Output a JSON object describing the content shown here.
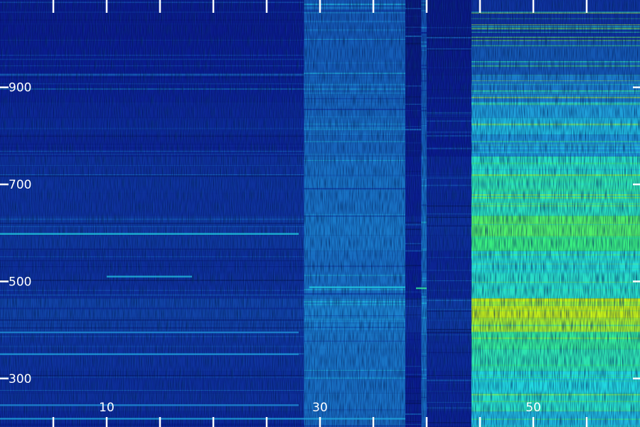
{
  "chart_data": {
    "type": "heatmap",
    "title": "",
    "xlabel": "",
    "ylabel": "",
    "xlim": [
      0,
      60
    ],
    "ylim": [
      200,
      1080
    ],
    "grid": false,
    "legend": "none",
    "x_tick_labels": [
      {
        "value": 10,
        "label": "10"
      },
      {
        "value": 30,
        "label": "30"
      },
      {
        "value": 50,
        "label": "50"
      }
    ],
    "x_minor_ticks": [
      5,
      10,
      15,
      20,
      25,
      30,
      35,
      40,
      45,
      50,
      55
    ],
    "y_tick_labels": [
      {
        "value": 300,
        "label": "300"
      },
      {
        "value": 500,
        "label": "500"
      },
      {
        "value": 700,
        "label": "700"
      },
      {
        "value": 900,
        "label": "900"
      }
    ],
    "colors": {
      "background": "#06104a",
      "low": "#0a1a8c",
      "mid": "#1e8fd6",
      "cyan": "#22d8e0",
      "green": "#3af07a",
      "yellow": "#e8f000",
      "tick": "#ffffff",
      "tick_label": "#ffffff"
    },
    "intensity_scale": [
      0,
      1
    ],
    "time_regions": [
      {
        "x0": 0,
        "x1": 28.5,
        "level": 0.18
      },
      {
        "x0": 28.5,
        "x1": 38,
        "level": 0.32
      },
      {
        "x0": 38,
        "x1": 39.5,
        "level": 0.14
      },
      {
        "x0": 39.5,
        "x1": 40,
        "level": 0.3
      },
      {
        "x0": 40,
        "x1": 44.2,
        "level": 0.16
      },
      {
        "x0": 44.2,
        "x1": 60,
        "level": 0.72
      }
    ],
    "frequency_bands": [
      {
        "y": 1030,
        "level": 0.2
      },
      {
        "y": 960,
        "level": 0.28
      },
      {
        "y": 890,
        "level": 0.36
      },
      {
        "y": 850,
        "level": 0.44
      },
      {
        "y": 825,
        "level": 0.5
      },
      {
        "y": 780,
        "level": 0.42
      },
      {
        "y": 735,
        "level": 0.62
      },
      {
        "y": 705,
        "level": 0.66
      },
      {
        "y": 660,
        "level": 0.64
      },
      {
        "y": 610,
        "level": 0.78
      },
      {
        "y": 580,
        "level": 0.74
      },
      {
        "y": 545,
        "level": 0.6
      },
      {
        "y": 490,
        "level": 0.62
      },
      {
        "y": 440,
        "level": 0.95
      },
      {
        "y": 410,
        "level": 0.9
      },
      {
        "y": 380,
        "level": 0.7
      },
      {
        "y": 340,
        "level": 0.66
      },
      {
        "y": 290,
        "level": 0.58
      },
      {
        "y": 250,
        "level": 0.62
      },
      {
        "y": 215,
        "level": 0.5
      }
    ],
    "narrowband_lines": [
      {
        "y": 598,
        "x0": 0,
        "x1": 28,
        "level": 0.55
      },
      {
        "y": 510,
        "x0": 10,
        "x1": 18,
        "level": 0.5
      },
      {
        "y": 488,
        "x0": 29,
        "x1": 38,
        "level": 0.55
      },
      {
        "y": 486,
        "x0": 39,
        "x1": 40,
        "level": 0.7
      },
      {
        "y": 395,
        "x0": 0,
        "x1": 28,
        "level": 0.4
      },
      {
        "y": 350,
        "x0": 0,
        "x1": 28,
        "level": 0.42
      },
      {
        "y": 245,
        "x0": 0,
        "x1": 28,
        "level": 0.4
      },
      {
        "y": 217,
        "x0": 0,
        "x1": 38,
        "level": 0.45
      }
    ]
  }
}
